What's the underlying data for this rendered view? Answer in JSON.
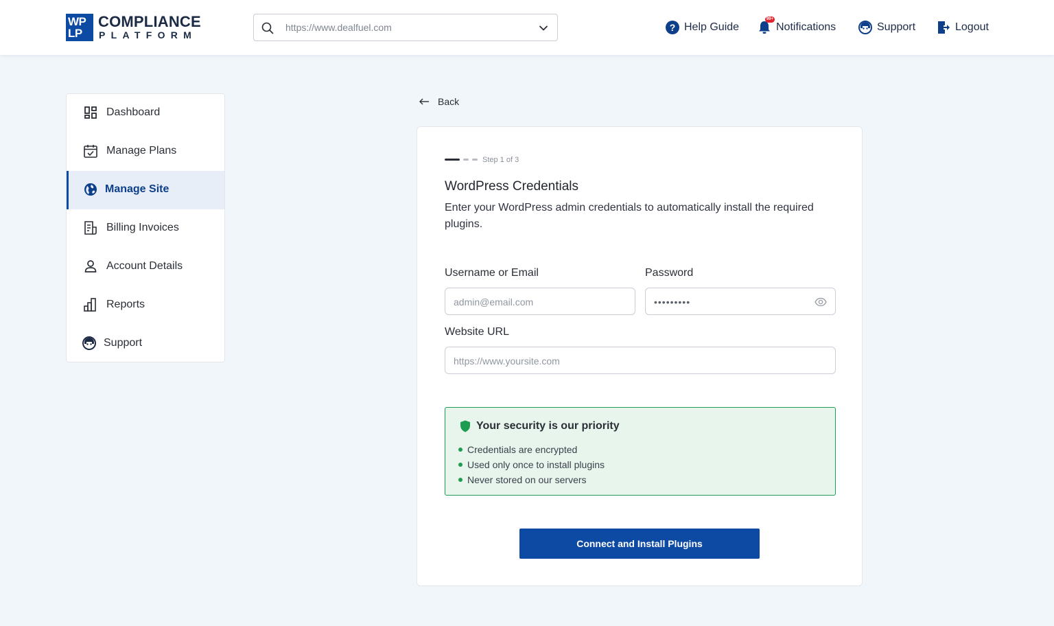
{
  "brand": {
    "mark_line1": "WP",
    "mark_line2": "LP",
    "title": "COMPLIANCE",
    "subtitle": "PLATFORM",
    "color": "#0d4aa3"
  },
  "header": {
    "site_select": {
      "value": "https://www.dealfuel.com",
      "icon": "search-icon"
    },
    "links": [
      {
        "label": "Help Guide",
        "icon": "help-icon"
      },
      {
        "label": "Notifications",
        "icon": "bell-icon",
        "badge": "99+"
      },
      {
        "label": "Support",
        "icon": "support-icon"
      },
      {
        "label": "Logout",
        "icon": "logout-icon"
      }
    ]
  },
  "sidebar": {
    "items": [
      {
        "label": "Dashboard",
        "icon": "dashboard-icon"
      },
      {
        "label": "Manage Plans",
        "icon": "calendar-icon"
      },
      {
        "label": "Manage Site",
        "icon": "globe-icon",
        "active": true
      },
      {
        "label": "Billing Invoices",
        "icon": "invoice-icon"
      },
      {
        "label": "Account Details",
        "icon": "user-icon"
      },
      {
        "label": "Reports",
        "icon": "reports-icon"
      },
      {
        "label": "Support",
        "icon": "support-icon"
      }
    ]
  },
  "main": {
    "back_label": "Back",
    "step_text": "Step 1 of 3",
    "title": "WordPress Credentials",
    "description": "Enter your WordPress admin credentials to automatically install the required plugins.",
    "fields": {
      "username_label": "Username or Email",
      "username_placeholder": "admin@email.com",
      "password_label": "Password",
      "password_value": "•••••••••",
      "website_label": "Website URL",
      "website_placeholder": "https://www.yoursite.com"
    },
    "security": {
      "title": "Your security is our priority",
      "points": [
        "Credentials are encrypted",
        "Used only once to install plugins",
        "Never stored on our servers"
      ],
      "accent": "#1e9c52"
    },
    "cta_label": "Connect and Install Plugins"
  }
}
